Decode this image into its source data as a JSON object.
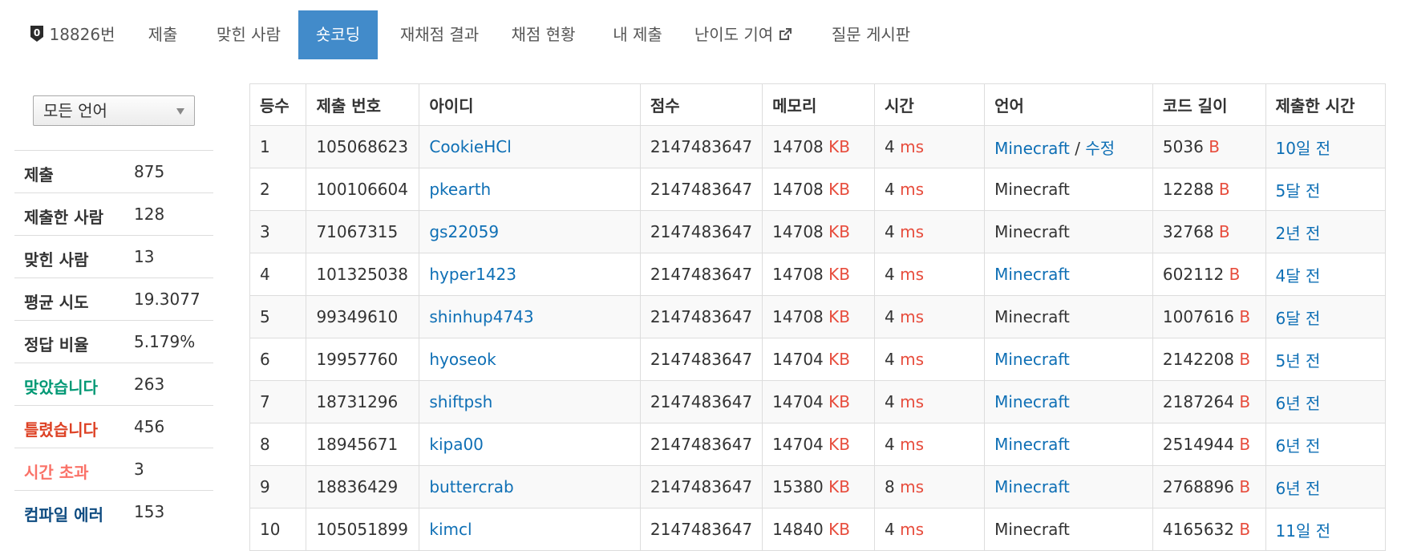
{
  "nav": {
    "problem_number": "18826번",
    "tabs": [
      {
        "label": "제출"
      },
      {
        "label": "맞힌 사람"
      },
      {
        "label": "숏코딩"
      },
      {
        "label": "재채점 결과"
      },
      {
        "label": "채점 현황"
      },
      {
        "label": "내 제출"
      },
      {
        "label": "난이도 기여"
      },
      {
        "label": "질문 게시판"
      }
    ],
    "active_tab": "숏코딩"
  },
  "sidebar": {
    "language_filter": "모든 언어",
    "stats": [
      {
        "label": "제출",
        "value": "875"
      },
      {
        "label": "제출한 사람",
        "value": "128"
      },
      {
        "label": "맞힌 사람",
        "value": "13"
      },
      {
        "label": "평균 시도",
        "value": "19.3077"
      },
      {
        "label": "정답 비율",
        "value": "5.179%"
      },
      {
        "label": "맞았습니다",
        "value": "263"
      },
      {
        "label": "틀렸습니다",
        "value": "456"
      },
      {
        "label": "시간 초과",
        "value": "3"
      },
      {
        "label": "컴파일 에러",
        "value": "153"
      }
    ]
  },
  "table": {
    "headers": [
      "등수",
      "제출 번호",
      "아이디",
      "점수",
      "메모리",
      "시간",
      "언어",
      "코드 길이",
      "제출한 시간"
    ],
    "units": {
      "memory": "KB",
      "time": "ms",
      "length": "B"
    },
    "edit_label": "수정",
    "rows": [
      {
        "rank": "1",
        "submission": "105068623",
        "user": "CookieHCl",
        "score": "2147483647",
        "memory": "14708",
        "time": "4",
        "lang": "Minecraft",
        "length": "5036",
        "when": "10일 전"
      },
      {
        "rank": "2",
        "submission": "100106604",
        "user": "pkearth",
        "score": "2147483647",
        "memory": "14708",
        "time": "4",
        "lang": "Minecraft",
        "length": "12288",
        "when": "5달 전"
      },
      {
        "rank": "3",
        "submission": "71067315",
        "user": "gs22059",
        "score": "2147483647",
        "memory": "14708",
        "time": "4",
        "lang": "Minecraft",
        "length": "32768",
        "when": "2년 전"
      },
      {
        "rank": "4",
        "submission": "101325038",
        "user": "hyper1423",
        "score": "2147483647",
        "memory": "14708",
        "time": "4",
        "lang": "Minecraft",
        "length": "602112",
        "when": "4달 전"
      },
      {
        "rank": "5",
        "submission": "99349610",
        "user": "shinhup4743",
        "score": "2147483647",
        "memory": "14708",
        "time": "4",
        "lang": "Minecraft",
        "length": "1007616",
        "when": "6달 전"
      },
      {
        "rank": "6",
        "submission": "19957760",
        "user": "hyoseok",
        "score": "2147483647",
        "memory": "14704",
        "time": "4",
        "lang": "Minecraft",
        "length": "2142208",
        "when": "5년 전"
      },
      {
        "rank": "7",
        "submission": "18731296",
        "user": "shiftpsh",
        "score": "2147483647",
        "memory": "14704",
        "time": "4",
        "lang": "Minecraft",
        "length": "2187264",
        "when": "6년 전"
      },
      {
        "rank": "8",
        "submission": "18945671",
        "user": "kipa00",
        "score": "2147483647",
        "memory": "14704",
        "time": "4",
        "lang": "Minecraft",
        "length": "2514944",
        "when": "6년 전"
      },
      {
        "rank": "9",
        "submission": "18836429",
        "user": "buttercrab",
        "score": "2147483647",
        "memory": "15380",
        "time": "8",
        "lang": "Minecraft",
        "length": "2768896",
        "when": "6년 전"
      },
      {
        "rank": "10",
        "submission": "105051899",
        "user": "kimcl",
        "score": "2147483647",
        "memory": "14840",
        "time": "4",
        "lang": "Minecraft",
        "length": "4165632",
        "when": "11일 전"
      }
    ]
  }
}
